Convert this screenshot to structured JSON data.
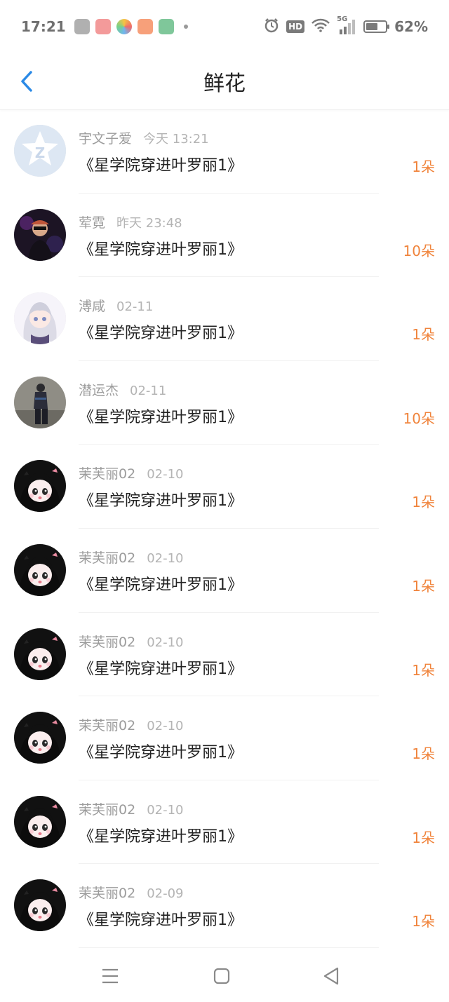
{
  "status_bar": {
    "time": "17:21",
    "battery": "62%",
    "battery_level": 0.62,
    "network": "5G",
    "hd_label": "HD",
    "app_icons": [
      "weibo-icon",
      "toutiao-icon",
      "photos-icon",
      "listen-icon",
      "oppo-store-icon"
    ],
    "app_icon_colors": [
      "#b0b0b0",
      "#f39a9a",
      "#9bc8f0",
      "#f7a07a",
      "#7fc79a"
    ]
  },
  "nav": {
    "title": "鲜花",
    "back_icon": "chevron-left-icon",
    "accent": "#2b8ae6"
  },
  "items": [
    {
      "name": "宇文子爱",
      "time": "今天 13:21",
      "book": "《星学院穿进叶罗丽1》",
      "flowers": "1朵",
      "avatar": "qq-default"
    },
    {
      "name": "荤霓",
      "time": "昨天 23:48",
      "book": "《星学院穿进叶罗丽1》",
      "flowers": "10朵",
      "avatar": "dark-figure"
    },
    {
      "name": "溥咸",
      "time": "02-11",
      "book": "《星学院穿进叶罗丽1》",
      "flowers": "1朵",
      "avatar": "silver-hair-girl"
    },
    {
      "name": "潜运杰",
      "time": "02-11",
      "book": "《星学院穿进叶罗丽1》",
      "flowers": "10朵",
      "avatar": "standing-person"
    },
    {
      "name": "茉芙丽02",
      "time": "02-10",
      "book": "《星学院穿进叶罗丽1》",
      "flowers": "1朵",
      "avatar": "anime-girl"
    },
    {
      "name": "茉芙丽02",
      "time": "02-10",
      "book": "《星学院穿进叶罗丽1》",
      "flowers": "1朵",
      "avatar": "anime-girl"
    },
    {
      "name": "茉芙丽02",
      "time": "02-10",
      "book": "《星学院穿进叶罗丽1》",
      "flowers": "1朵",
      "avatar": "anime-girl"
    },
    {
      "name": "茉芙丽02",
      "time": "02-10",
      "book": "《星学院穿进叶罗丽1》",
      "flowers": "1朵",
      "avatar": "anime-girl"
    },
    {
      "name": "茉芙丽02",
      "time": "02-10",
      "book": "《星学院穿进叶罗丽1》",
      "flowers": "1朵",
      "avatar": "anime-girl"
    },
    {
      "name": "茉芙丽02",
      "time": "02-09",
      "book": "《星学院穿进叶罗丽1》",
      "flowers": "1朵",
      "avatar": "anime-girl"
    }
  ],
  "colors": {
    "flower_count": "#f0843c",
    "name_text": "#9c9c9c",
    "book_text": "#222222"
  },
  "bottom_nav": {
    "icons": [
      "menu-icon",
      "home-icon",
      "back-triangle-icon"
    ]
  }
}
